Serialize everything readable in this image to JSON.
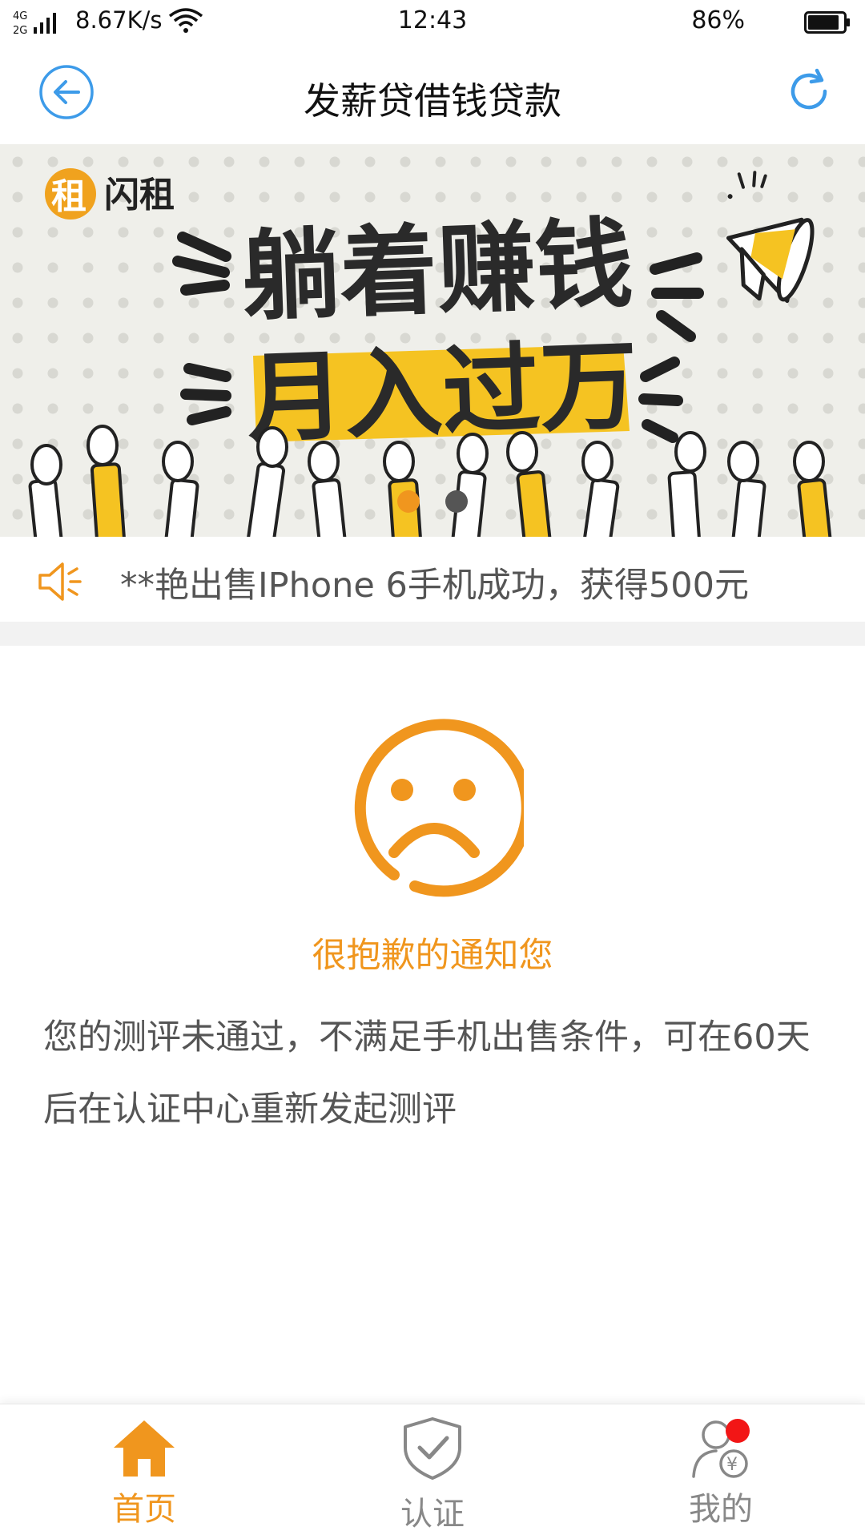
{
  "status_bar": {
    "network": "4G 2G",
    "speed": "8.67K/s",
    "time": "12:43",
    "battery": "86%"
  },
  "header": {
    "title": "发薪贷借钱贷款",
    "accent": "#3d9be9"
  },
  "banner": {
    "brand": "闪租",
    "headline_1": "躺着赚钱",
    "headline_2": "月入过万",
    "page_count": 2,
    "active_page": 1
  },
  "notice": {
    "text": "**艳出售IPhone 6手机成功，获得500元"
  },
  "result": {
    "title": "很抱歉的通知您",
    "message": "您的测评未通过，不满足手机出售条件，可在60天后在认证中心重新发起测评",
    "accent": "#f0961e"
  },
  "tabbar": {
    "items": [
      {
        "label": "首页",
        "icon": "home-icon",
        "active": true
      },
      {
        "label": "认证",
        "icon": "shield-check-icon",
        "active": false
      },
      {
        "label": "我的",
        "icon": "user-yuan-icon",
        "active": false
      }
    ]
  }
}
